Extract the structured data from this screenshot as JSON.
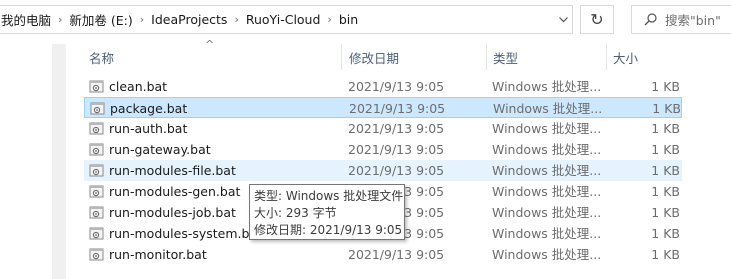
{
  "address_bar": {
    "crumbs": [
      "我的电脑",
      "新加卷 (E:)",
      "IdeaProjects",
      "RuoYi-Cloud",
      "bin"
    ],
    "separator": "›",
    "dropdown_icon": "chevron-down-icon"
  },
  "refresh": {
    "icon": "refresh-icon",
    "glyph": "↻"
  },
  "search": {
    "placeholder": "搜索\"bin\"",
    "icon": "search-icon"
  },
  "columns": {
    "name": "名称",
    "date": "修改日期",
    "type": "类型",
    "size": "大小"
  },
  "sort": {
    "column": "name",
    "glyph": "^"
  },
  "files": [
    {
      "name": "clean.bat",
      "date": "2021/9/13 9:05",
      "type": "Windows 批处理...",
      "size": "1 KB"
    },
    {
      "name": "package.bat",
      "date": "2021/9/13 9:05",
      "type": "Windows 批处理...",
      "size": "1 KB"
    },
    {
      "name": "run-auth.bat",
      "date": "2021/9/13 9:05",
      "type": "Windows 批处理...",
      "size": "1 KB"
    },
    {
      "name": "run-gateway.bat",
      "date": "2021/9/13 9:05",
      "type": "Windows 批处理...",
      "size": "1 KB"
    },
    {
      "name": "run-modules-file.bat",
      "date": "2021/9/13 9:05",
      "type": "Windows 批处理...",
      "size": "1 KB"
    },
    {
      "name": "run-modules-gen.bat",
      "date": "2021/9/13 9:05",
      "type": "Windows 批处理...",
      "size": "1 KB"
    },
    {
      "name": "run-modules-job.bat",
      "date": "2021/9/13 9:05",
      "type": "Windows 批处理...",
      "size": "1 KB"
    },
    {
      "name": "run-modules-system.bat",
      "date": "2021/9/13 9:05",
      "type": "Windows 批处理...",
      "size": "1 KB"
    },
    {
      "name": "run-monitor.bat",
      "date": "2021/9/13 9:05",
      "type": "Windows 批处理...",
      "size": "1 KB"
    }
  ],
  "selected_index": 1,
  "hover_index": 4,
  "tooltip": {
    "line1": "类型: Windows 批处理文件",
    "line2": "大小: 293 字节",
    "line3": "修改日期: 2021/9/13 9:05"
  },
  "colors": {
    "selected_bg": "#cce8ff",
    "selected_border": "#99d1ff",
    "hover_bg": "#e5f3ff",
    "header_text": "#4c607a"
  }
}
